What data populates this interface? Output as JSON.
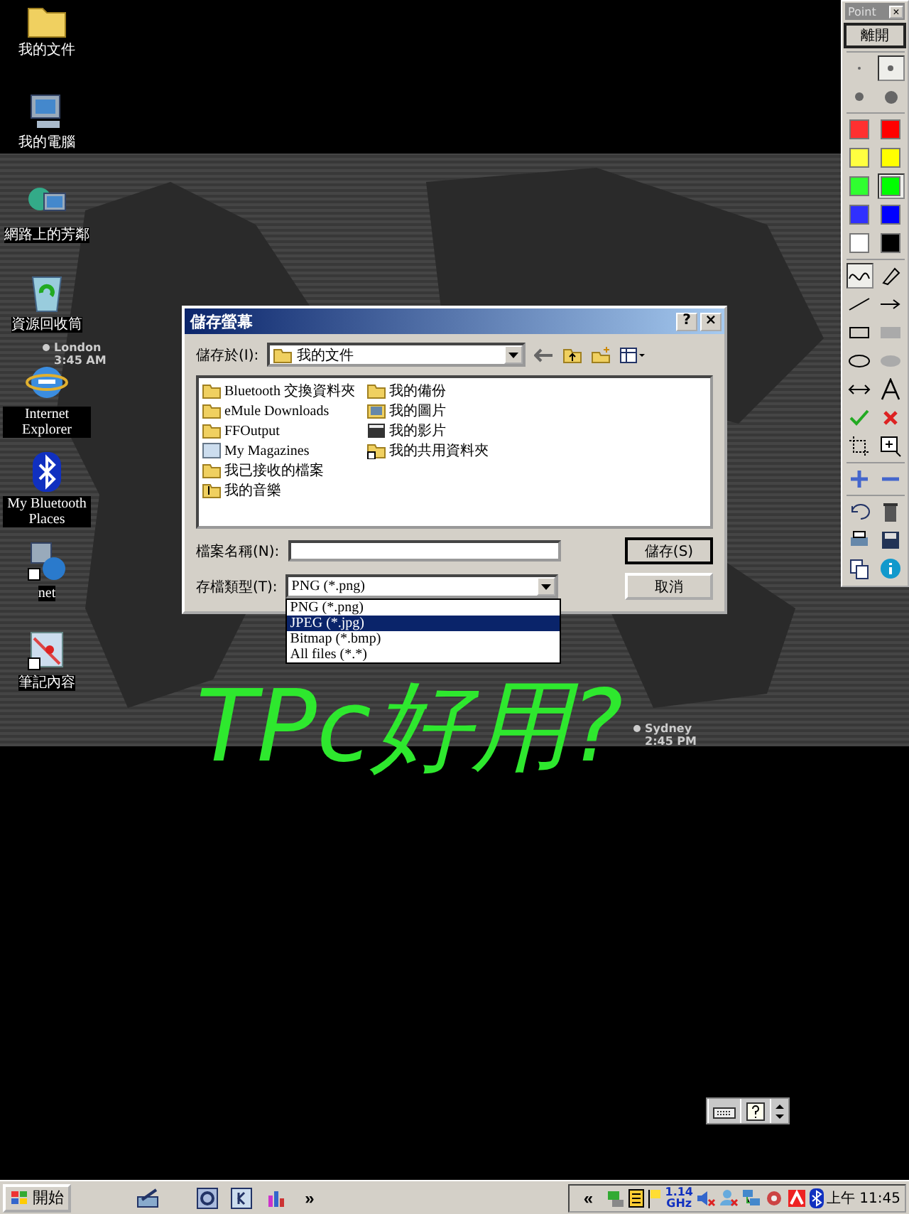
{
  "desktop": {
    "icons": [
      {
        "label": "我的文件"
      },
      {
        "label": "我的電腦"
      },
      {
        "label": "網路上的芳鄰"
      },
      {
        "label": "資源回收筒"
      },
      {
        "label": "Internet Explorer"
      },
      {
        "label": "My Bluetooth Places"
      },
      {
        "label": "net"
      },
      {
        "label": "筆記內容"
      }
    ],
    "clocks": [
      {
        "city": "London",
        "time": "3:45 AM"
      },
      {
        "city": "Sydney",
        "time": "2:45 PM"
      }
    ]
  },
  "dialog": {
    "title": "儲存螢幕",
    "help": "?",
    "close": "×",
    "save_in_label": "儲存於(I):",
    "save_in_value": "我的文件",
    "files": [
      {
        "name": "Bluetooth 交換資料夾"
      },
      {
        "name": "eMule Downloads"
      },
      {
        "name": "FFOutput"
      },
      {
        "name": "My Magazines"
      },
      {
        "name": "我已接收的檔案"
      },
      {
        "name": "我的音樂"
      },
      {
        "name": "我的備份"
      },
      {
        "name": "我的圖片"
      },
      {
        "name": "我的影片"
      },
      {
        "name": "我的共用資料夾"
      }
    ],
    "filename_label": "檔案名稱(N):",
    "type_label": "存檔類型(T):",
    "type_value": "PNG (*.png)",
    "type_options": [
      {
        "label": "PNG (*.png)",
        "selected": false
      },
      {
        "label": "JPEG (*.jpg)",
        "selected": true
      },
      {
        "label": "Bitmap (*.bmp)",
        "selected": false
      },
      {
        "label": "All files (*.*)",
        "selected": false
      }
    ],
    "buttons": [
      "儲存(S)",
      "取消"
    ]
  },
  "ink": {
    "text": "TPc好用?"
  },
  "pen_toolbar": {
    "title": "Point",
    "close": "×",
    "exit": "離開",
    "pen_sizes": [
      {
        "selected": false
      },
      {
        "selected": true
      },
      {
        "selected": false
      },
      {
        "selected": false
      }
    ],
    "colors": [
      {
        "color": "#ff3030",
        "selected": false
      },
      {
        "color": "#ff0000",
        "selected": false
      },
      {
        "color": "#ffff40",
        "selected": false
      },
      {
        "color": "#ffff00",
        "selected": false
      },
      {
        "color": "#30ff30",
        "selected": false
      },
      {
        "color": "#00ff00",
        "selected": true
      },
      {
        "color": "#3030ff",
        "selected": false
      },
      {
        "color": "#0000ff",
        "selected": false
      },
      {
        "color": "#ffffff",
        "selected": false
      },
      {
        "color": "#000000",
        "selected": false
      }
    ],
    "tools": [
      {
        "selected": true
      },
      {
        "selected": false
      },
      {
        "selected": false
      },
      {
        "selected": false
      },
      {
        "selected": false
      },
      {
        "selected": false
      },
      {
        "selected": false
      },
      {
        "selected": false
      },
      {
        "selected": false
      },
      {
        "selected": false
      },
      {
        "selected": false
      },
      {
        "selected": false
      },
      {
        "selected": false
      },
      {
        "selected": false
      }
    ]
  },
  "taskbar": {
    "start": "開始",
    "more": "»",
    "tray_expand": "«",
    "cpu_speed": "1.14",
    "cpu_unit": "GHz",
    "clock": "上午 11:45"
  }
}
